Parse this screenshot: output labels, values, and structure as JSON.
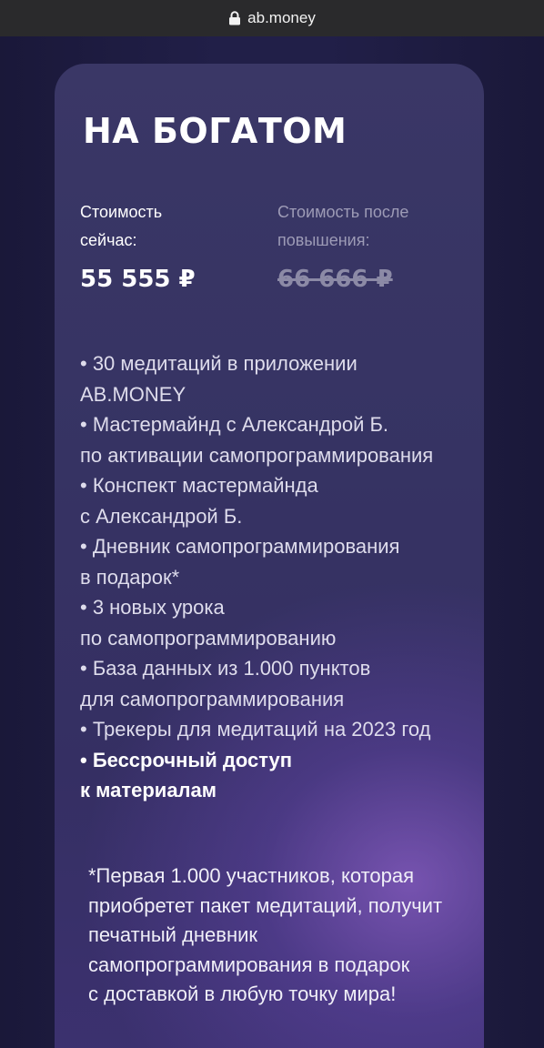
{
  "browser": {
    "url": "ab.money",
    "lock_icon": "lock-icon"
  },
  "card": {
    "title": "НА БОГАТОМ",
    "price_now": {
      "label_line1": "Стоимость",
      "label_line2": "сейчас:",
      "value": "55 555 ₽"
    },
    "price_after": {
      "label_line1": "Стоимость после",
      "label_line2": "повышения:",
      "value": "66 666 ₽"
    },
    "features": [
      " • 30 медитаций в приложении",
      "AB.MONEY",
      " • Мастермайнд с Александрой Б.",
      "по активации самопрограммирования",
      " • Конспект мастермайнда",
      "с Александрой Б.",
      " • Дневник самопрограммирования",
      "в подарок*",
      " • 3 новых урока",
      "по самопрограммированию",
      " • База данных из 1.000 пунктов",
      "для самопрограммирования",
      " • Трекеры для медитаций на 2023 год"
    ],
    "features_bold": [
      " • Бессрочный доступ",
      "к материалам"
    ],
    "note": [
      "*Первая 1.000 участников, которая",
      "приобретет пакет медитаций, получит",
      "печатный дневник",
      "самопрограммирования в подарок",
      "с доставкой в любую точку мира!"
    ]
  },
  "colors": {
    "background": "#1c1a40",
    "card": "#38356a",
    "accent_glow": "#8c5fc8",
    "strike_price": "#8c8aa6"
  }
}
